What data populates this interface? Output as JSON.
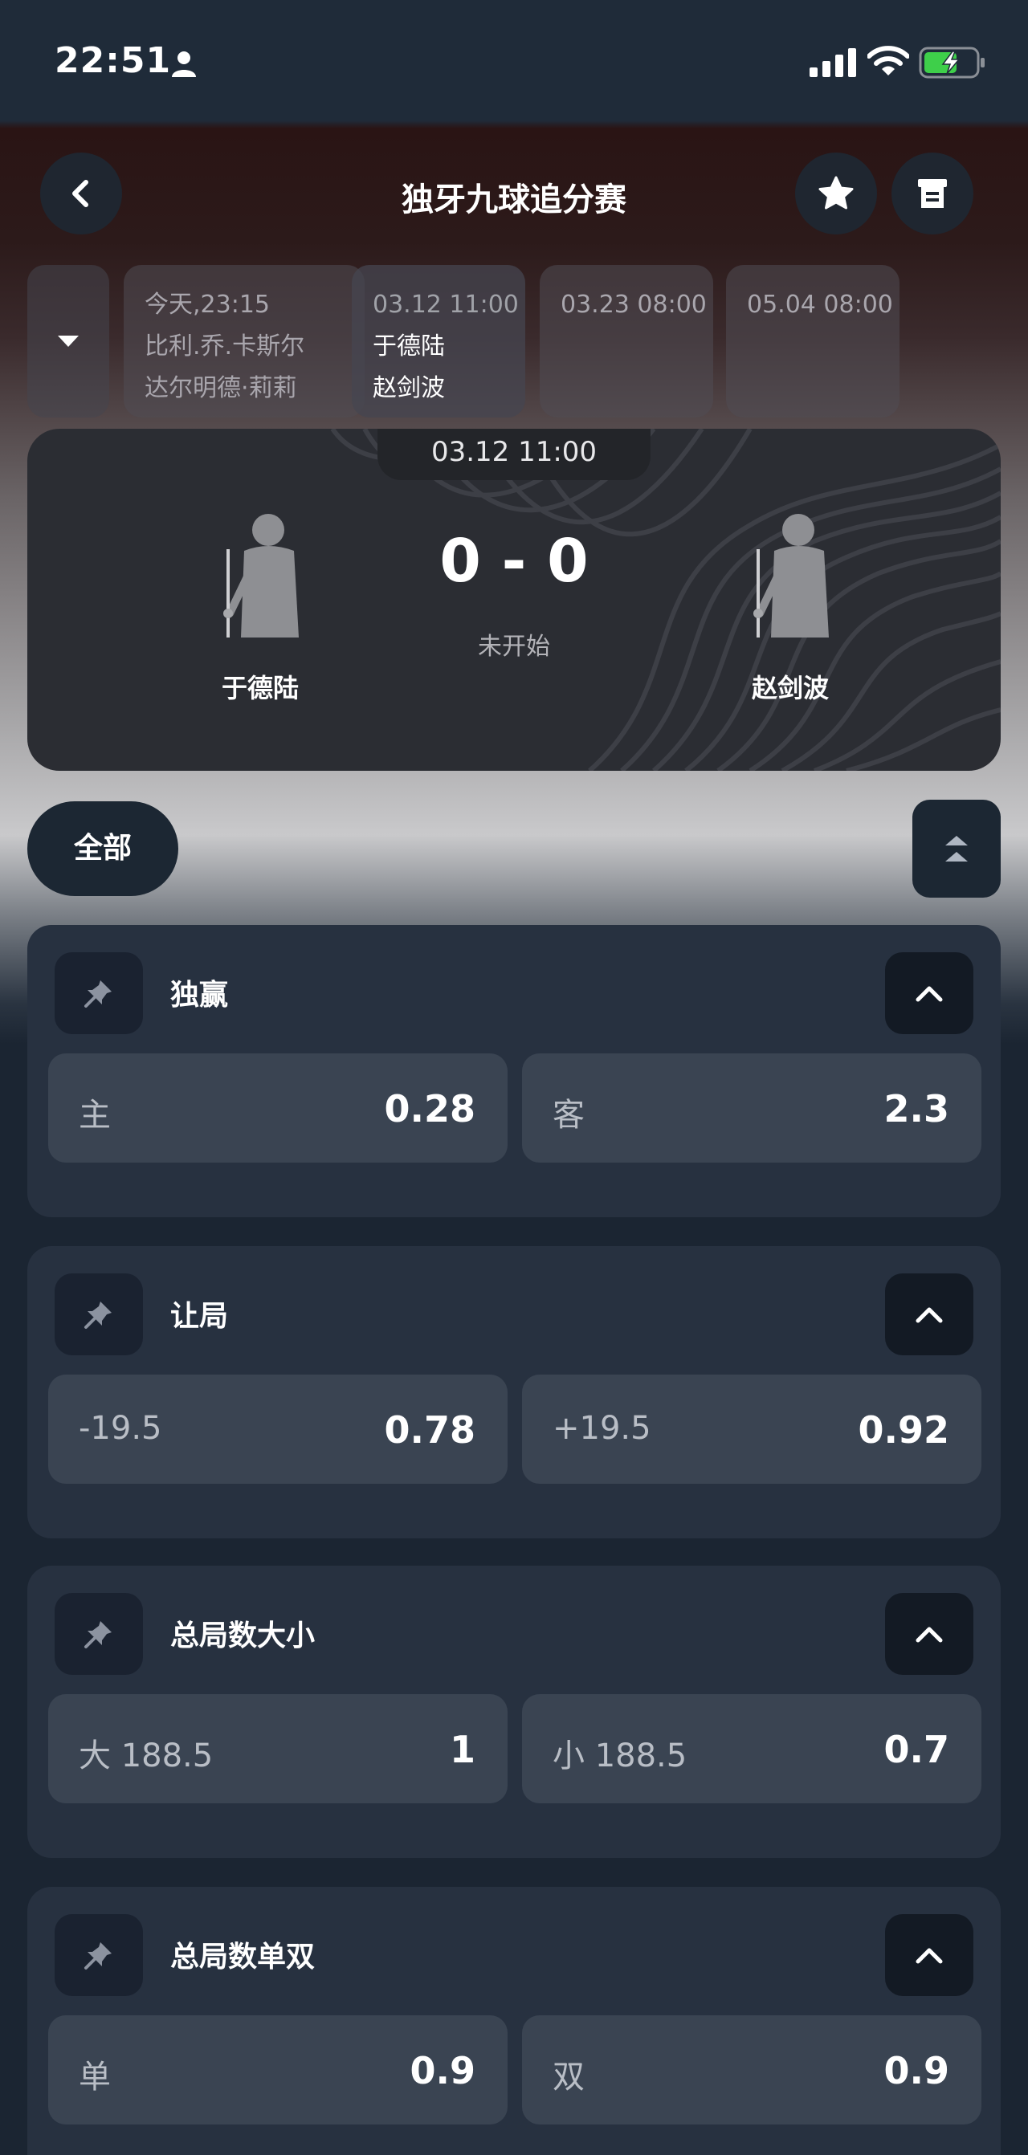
{
  "status_bar": {
    "time": "22:51"
  },
  "header": {
    "title": "独牙九球追分赛"
  },
  "match_strip": [
    {
      "time": "今天,23:15",
      "player1": "比利.乔.卡斯尔",
      "player2": "达尔明德·莉莉"
    },
    {
      "time": "03.12 11:00",
      "player1": "于德陆",
      "player2": "赵剑波"
    },
    {
      "time": "03.23 08:00",
      "player1": "",
      "player2": ""
    },
    {
      "time": "05.04 08:00",
      "player1": "",
      "player2": ""
    }
  ],
  "scoreboard": {
    "date": "03.12 11:00",
    "home_player": "于德陆",
    "away_player": "赵剑波",
    "score": "0 - 0",
    "state": "未开始"
  },
  "filter": {
    "all_label": "全部"
  },
  "markets": [
    {
      "title": "独赢",
      "left_label": "主",
      "left_value": "0.28",
      "right_label": "客",
      "right_value": "2.3"
    },
    {
      "title": "让局",
      "left_label": "-19.5",
      "left_value": "0.78",
      "right_label": "+19.5",
      "right_value": "0.92"
    },
    {
      "title": "总局数大小",
      "left_label": "大 188.5",
      "left_value": "1",
      "right_label": "小 188.5",
      "right_value": "0.7"
    },
    {
      "title": "总局数单双",
      "left_label": "单",
      "left_value": "0.9",
      "right_label": "双",
      "right_value": "0.9"
    }
  ],
  "icons": {
    "back": "chevron-left-icon",
    "favorite": "star-icon",
    "stats": "document-icon",
    "expand": "caret-down-icon",
    "collapse_all": "double-chevron-up-icon",
    "pin": "pin-icon",
    "collapse": "chevron-up-icon"
  },
  "colors": {
    "background": "#1b2532",
    "card": "#273140",
    "odd_button": "#3a4452",
    "battery_green": "#3ecf4a"
  }
}
